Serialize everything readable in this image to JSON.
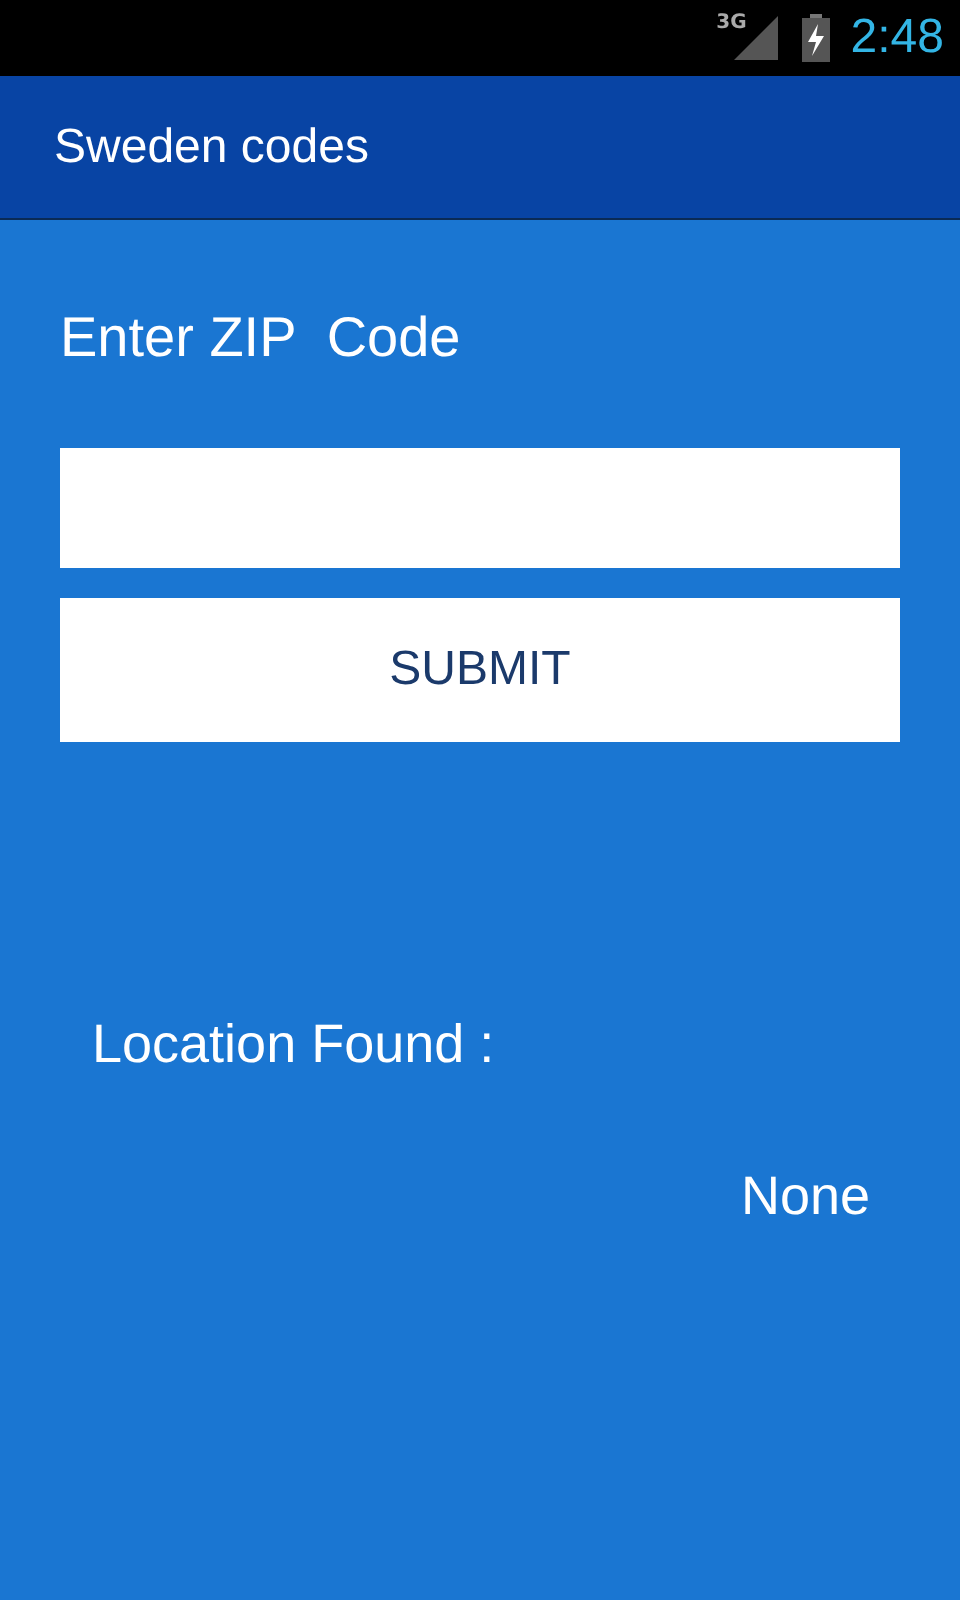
{
  "status_bar": {
    "network": "3G",
    "time": "2:48"
  },
  "app_bar": {
    "title": "Sweden codes"
  },
  "form": {
    "label": "Enter ZIP  Code",
    "submit": "SUBMIT"
  },
  "result": {
    "label": "Location Found :",
    "value": "None"
  }
}
